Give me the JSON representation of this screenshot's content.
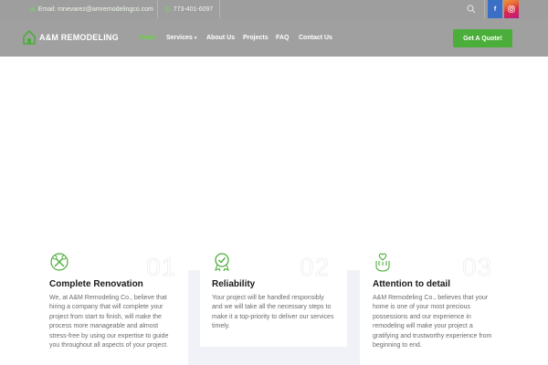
{
  "topbar": {
    "email": "Email: mnevarez@amremodelingco.com",
    "phone": "773-401-6097",
    "social": {
      "facebook": "f",
      "instagram": "ig"
    }
  },
  "brand": {
    "name": "A&M REMODELING"
  },
  "nav": {
    "home": "Home",
    "services": "Services",
    "about": "About Us",
    "projects": "Projects",
    "faq": "FAQ",
    "contact": "Contact Us"
  },
  "cta": {
    "quote": "Get A Quote!"
  },
  "features": [
    {
      "number": "01",
      "title": "Complete Renovation",
      "text": "We, at A&M Remodeling Co., believe that hiring a company that will complete your project from start to finish, will make the process more manageable and almost stress-free by using our expertise to guide you throughout all aspects of your project.",
      "icon": "tools-icon"
    },
    {
      "number": "02",
      "title": "Reliability",
      "text": "Your project will be handled responsibly and we will take all the necessary steps to make it a top-priority to deliver our services timely.",
      "icon": "award-badge-icon"
    },
    {
      "number": "03",
      "title": "Attention to detail",
      "text": "A&M Remodeling Co., believes that your home is one of your most precious possessions and our experience in remodeling will make your project a gratifying and trustworthy experience from beginning to end.",
      "icon": "hand-care-icon"
    }
  ],
  "colors": {
    "accent": "#4cae3a",
    "nav_active": "#6fcf4d",
    "header_bg": "#a0a0a0"
  }
}
